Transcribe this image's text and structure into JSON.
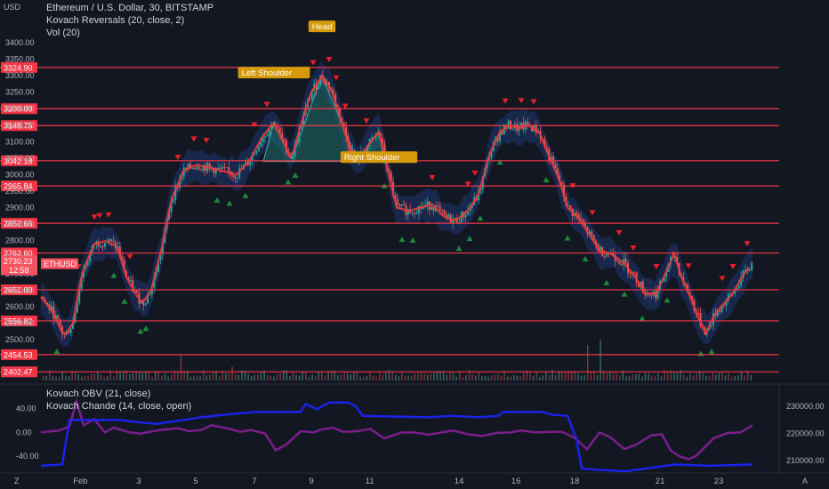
{
  "header": {
    "symbol_line": "Ethereum / U.S. Dollar, 30, BITSTAMP",
    "indicator1": "Kovach Reversals (20, close, 2)",
    "indicator2": "Vol (20)",
    "currency": "USD"
  },
  "lower_pane": {
    "obv_label": "Kovach OBV (21, close)",
    "chande_label": "Kovach Chande (14, close, open)",
    "left_ticks": [
      "40.00",
      "0.00",
      "-40.00"
    ],
    "left_tick_values": [
      40,
      0,
      -40
    ],
    "right_ticks": [
      "230000.00",
      "220000.00",
      "210000.00"
    ],
    "right_tick_values": [
      230000,
      220000,
      210000
    ]
  },
  "price_axis": {
    "ticks": [
      "3400.00",
      "3350.00",
      "3300.00",
      "3250.00",
      "3200.00",
      "3150.00",
      "3100.00",
      "3050.00",
      "3000.00",
      "2950.00",
      "2900.00",
      "2850.00",
      "2800.00",
      "2750.00",
      "2700.00",
      "2650.00",
      "2600.00",
      "2550.00",
      "2500.00"
    ],
    "tick_values": [
      3400,
      3350,
      3300,
      3250,
      3200,
      3150,
      3100,
      3050,
      3000,
      2950,
      2900,
      2850,
      2800,
      2750,
      2700,
      2650,
      2600,
      2550,
      2500
    ],
    "level_labels": [
      "3324.90",
      "3200.00",
      "3148.75",
      "3042.18",
      "2965.84",
      "2852.66",
      "2762.60",
      "2651.00",
      "2556.82",
      "2454.53",
      "2402.47"
    ],
    "level_values": [
      3324.9,
      3200.0,
      3148.75,
      3042.18,
      2965.84,
      2852.66,
      2762.6,
      2651.0,
      2556.82,
      2454.53,
      2402.47
    ],
    "last_price": "2730.23",
    "last_price_value": 2730.23,
    "countdown": "12:58",
    "ticker_tag": "ETHUSD"
  },
  "time_axis": {
    "labels": [
      "Feb",
      "3",
      "5",
      "7",
      "9",
      "11",
      "14",
      "16",
      "18",
      "21",
      "23"
    ],
    "label_positions": [
      2.2,
      5.5,
      8.7,
      12.0,
      15.2,
      18.5,
      23.5,
      26.7,
      30.0,
      34.8,
      38.1
    ]
  },
  "pattern_labels": [
    "Left Shoulder",
    "Head",
    "Right Shoulder"
  ],
  "bottom_icons": {
    "left": "Z",
    "right": "A"
  },
  "colors": {
    "background": "#131722",
    "level_line": "#f23645",
    "level_badge": "#f23645",
    "ticker_badge": "#f7525f",
    "pattern_badge": "#d59a09",
    "candle_up": "#26a69a",
    "candle_down": "#ef5350",
    "ma_line": "#e63c3c",
    "band_fill": "#1e3570",
    "obv_line": "#1c22e8",
    "chande_line": "#7b1e8c",
    "signal_up": "#1b8a3a",
    "signal_down": "#e0202a"
  },
  "chart_data": {
    "type": "candlestick",
    "title": "Ethereum / U.S. Dollar, 30, BITSTAMP",
    "ylabel": "USD",
    "ylim": [
      2460,
      3410
    ],
    "x_index_range": [
      0,
      40
    ],
    "price_path": [
      [
        0,
        2630
      ],
      [
        0.7,
        2580
      ],
      [
        1.3,
        2510
      ],
      [
        1.8,
        2550
      ],
      [
        2.3,
        2700
      ],
      [
        3,
        2790
      ],
      [
        3.7,
        2800
      ],
      [
        4.3,
        2780
      ],
      [
        4.8,
        2690
      ],
      [
        5.3,
        2640
      ],
      [
        5.7,
        2610
      ],
      [
        6.2,
        2650
      ],
      [
        6.8,
        2780
      ],
      [
        7.3,
        2920
      ],
      [
        8,
        3010
      ],
      [
        8.7,
        3030
      ],
      [
        9.5,
        3020
      ],
      [
        10.3,
        3010
      ],
      [
        11,
        3000
      ],
      [
        11.7,
        3040
      ],
      [
        12.4,
        3110
      ],
      [
        13.1,
        3160
      ],
      [
        13.6,
        3100
      ],
      [
        14.1,
        3050
      ],
      [
        14.6,
        3150
      ],
      [
        15.2,
        3250
      ],
      [
        15.8,
        3300
      ],
      [
        16.3,
        3260
      ],
      [
        16.8,
        3180
      ],
      [
        17.3,
        3090
      ],
      [
        17.8,
        3040
      ],
      [
        18.4,
        3090
      ],
      [
        19,
        3130
      ],
      [
        19.5,
        3010
      ],
      [
        20,
        2900
      ],
      [
        20.7,
        2890
      ],
      [
        21.3,
        2900
      ],
      [
        22,
        2910
      ],
      [
        22.7,
        2870
      ],
      [
        23.3,
        2860
      ],
      [
        24,
        2890
      ],
      [
        24.6,
        2940
      ],
      [
        25.2,
        3060
      ],
      [
        25.8,
        3130
      ],
      [
        26.3,
        3150
      ],
      [
        26.8,
        3140
      ],
      [
        27.4,
        3150
      ],
      [
        28,
        3130
      ],
      [
        28.6,
        3050
      ],
      [
        29.1,
        2990
      ],
      [
        29.6,
        2900
      ],
      [
        30.2,
        2870
      ],
      [
        30.8,
        2820
      ],
      [
        31.4,
        2770
      ],
      [
        32.1,
        2760
      ],
      [
        32.8,
        2730
      ],
      [
        33.4,
        2690
      ],
      [
        34,
        2640
      ],
      [
        34.6,
        2640
      ],
      [
        35.1,
        2700
      ],
      [
        35.6,
        2760
      ],
      [
        36,
        2690
      ],
      [
        36.5,
        2630
      ],
      [
        37,
        2560
      ],
      [
        37.4,
        2520
      ],
      [
        37.9,
        2580
      ],
      [
        38.4,
        2610
      ],
      [
        38.9,
        2640
      ],
      [
        39.4,
        2690
      ],
      [
        40,
        2730
      ]
    ],
    "pattern": {
      "left_shoulder": [
        13.1,
        3160
      ],
      "head": [
        15.8,
        3300
      ],
      "right_shoulder": [
        19.0,
        3130
      ],
      "neckline_start": [
        12.5,
        3040
      ],
      "neckline_end": [
        19.3,
        3040
      ]
    },
    "buy_signals": [
      0.9,
      4.1,
      4.7,
      5.6,
      5.9,
      9.9,
      10.6,
      11.5,
      13.9,
      14.3,
      19.3,
      20.3,
      20.9,
      23.5,
      24.1,
      24.7,
      25.8,
      28.4,
      29.6,
      30.6,
      31.8,
      32.8,
      33.8,
      35.2,
      37.1,
      37.7
    ],
    "sell_signals": [
      2.1,
      3.0,
      3.3,
      3.8,
      5.0,
      7.7,
      8.6,
      9.3,
      12.0,
      12.7,
      15.3,
      16.2,
      16.6,
      17.1,
      18.3,
      22.0,
      24.0,
      24.4,
      26.1,
      27.0,
      27.7,
      29.9,
      31.0,
      32.5,
      33.3,
      34.6,
      36.4,
      38.3,
      38.9,
      39.7
    ],
    "volume_base": 4,
    "obv_series": {
      "name": "Kovach OBV (21, close)",
      "ylim": [
        206000,
        237000
      ],
      "points": [
        [
          0,
          208000
        ],
        [
          1.2,
          208500
        ],
        [
          1.6,
          225000
        ],
        [
          4.5,
          225000
        ],
        [
          5,
          224500
        ],
        [
          6.5,
          223500
        ],
        [
          7.5,
          224500
        ],
        [
          9,
          226000
        ],
        [
          10.4,
          227000
        ],
        [
          12.1,
          228000
        ],
        [
          14.6,
          228000
        ],
        [
          14.9,
          231000
        ],
        [
          15.5,
          229000
        ],
        [
          16.2,
          231500
        ],
        [
          17.3,
          231500
        ],
        [
          17.7,
          230000
        ],
        [
          18.1,
          226500
        ],
        [
          21.8,
          226000
        ],
        [
          23.1,
          226500
        ],
        [
          24.6,
          226000
        ],
        [
          25.7,
          226500
        ],
        [
          26,
          228000
        ],
        [
          28.2,
          228000
        ],
        [
          28.7,
          227000
        ],
        [
          29.6,
          226500
        ],
        [
          30.1,
          218000
        ],
        [
          30.4,
          207000
        ],
        [
          31.3,
          206500
        ],
        [
          32.9,
          206000
        ],
        [
          34,
          207000
        ],
        [
          35.1,
          208000
        ],
        [
          35.7,
          208500
        ],
        [
          37.6,
          208000
        ],
        [
          40,
          208500
        ]
      ]
    },
    "chande_series": {
      "name": "Kovach Chande (14, close, open)",
      "ylim": [
        -65,
        75
      ],
      "points": [
        [
          0,
          0
        ],
        [
          1,
          3
        ],
        [
          1.6,
          10
        ],
        [
          2,
          52
        ],
        [
          2.4,
          12
        ],
        [
          3,
          22
        ],
        [
          3.6,
          0
        ],
        [
          4.1,
          8
        ],
        [
          5,
          0
        ],
        [
          5.6,
          -2
        ],
        [
          6.3,
          2
        ],
        [
          7,
          5
        ],
        [
          7.7,
          7
        ],
        [
          8.3,
          2
        ],
        [
          9,
          4
        ],
        [
          9.6,
          12
        ],
        [
          10.6,
          6
        ],
        [
          11.2,
          1
        ],
        [
          11.8,
          4
        ],
        [
          12.6,
          -2
        ],
        [
          13.2,
          -30
        ],
        [
          13.8,
          -20
        ],
        [
          14.6,
          2
        ],
        [
          15.3,
          0
        ],
        [
          15.8,
          5
        ],
        [
          16.4,
          8
        ],
        [
          17,
          1
        ],
        [
          17.8,
          2
        ],
        [
          18.5,
          6
        ],
        [
          19.3,
          -10
        ],
        [
          20.3,
          0
        ],
        [
          21,
          0
        ],
        [
          21.8,
          -4
        ],
        [
          22.5,
          0
        ],
        [
          23.2,
          3
        ],
        [
          24,
          -3
        ],
        [
          24.8,
          -6
        ],
        [
          25.6,
          -1
        ],
        [
          26.4,
          0
        ],
        [
          27,
          3
        ],
        [
          27.8,
          0
        ],
        [
          28.6,
          1
        ],
        [
          29.3,
          1
        ],
        [
          30,
          -9
        ],
        [
          30.7,
          -28
        ],
        [
          31.4,
          0
        ],
        [
          32,
          -8
        ],
        [
          32.8,
          -28
        ],
        [
          33.5,
          -20
        ],
        [
          34.3,
          -5
        ],
        [
          34.9,
          -3
        ],
        [
          35.4,
          -30
        ],
        [
          35.9,
          -40
        ],
        [
          36.4,
          -45
        ],
        [
          36.8,
          -40
        ],
        [
          37.2,
          -28
        ],
        [
          37.8,
          -10
        ],
        [
          38.6,
          -1
        ],
        [
          39.3,
          0
        ],
        [
          40,
          12
        ]
      ]
    }
  }
}
